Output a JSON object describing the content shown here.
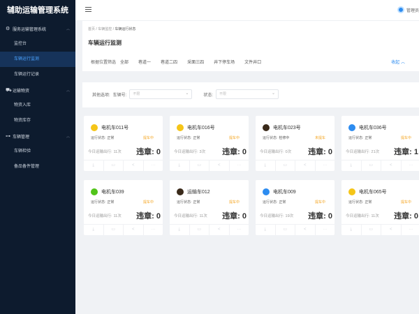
{
  "app_title": "辅助运输管理系统",
  "sidebar": {
    "groups": [
      {
        "label": "服务运输管理系统",
        "icon": "gear-icon"
      },
      {
        "label": "运输物资",
        "icon": "truck-icon"
      },
      {
        "label": "车辆管理",
        "icon": "car-icon"
      }
    ],
    "items": {
      "dashboard": "监控台",
      "monitor": "车辆运行监测",
      "records": "车辆运行记录",
      "material_in": "物资入库",
      "material_stock": "物资库存",
      "inspect": "车辆检验",
      "spare_parts": "备品备件管理"
    }
  },
  "header": {
    "user": "管理员"
  },
  "breadcrumb": [
    "首页",
    "车辆监控",
    "车辆运行状态"
  ],
  "page_title": "车辆运行监测",
  "filters": {
    "location_label": "根据位置筛选",
    "options": [
      "全部",
      "巷道一",
      "巷道二四",
      "采面三四",
      "井下停车场",
      "文件井口"
    ],
    "collapse": "收起",
    "other_label": "其他选项:",
    "vehicle_label": "车辆号:",
    "vehicle_placeholder": "不限",
    "status_label": "状态:",
    "status_placeholder": "不限"
  },
  "labels": {
    "status": "运行状态:",
    "trips": "今日运输出行:",
    "violation_prefix": "违章:"
  },
  "icons": [
    "download-icon",
    "edit-icon",
    "share-icon",
    "more-icon"
  ],
  "cards": [
    {
      "name": "电机车011号",
      "icon_color": "#f5c518",
      "status": "正常",
      "warn": "提车中",
      "trips": "11次",
      "violations": "0"
    },
    {
      "name": "电机车016号",
      "icon_color": "#f5c518",
      "status": "正常",
      "warn": "提车中",
      "trips": "3次",
      "violations": "0"
    },
    {
      "name": "电机车023号",
      "icon_color": "#3a2a1a",
      "status": "检修中",
      "warn": "未提车",
      "trips": "0次",
      "violations": "0"
    },
    {
      "name": "电机车036号",
      "icon_color": "#2d8cf0",
      "status": "正常",
      "warn": "提车中",
      "trips": "21次",
      "violations": "1"
    },
    {
      "name": "电机车039",
      "icon_color": "#52c41a",
      "status": "正常",
      "warn": "提车中",
      "trips": "11次",
      "violations": "0"
    },
    {
      "name": "运输车012",
      "icon_color": "#3a2a1a",
      "status": "正常",
      "warn": "提车中",
      "trips": "11次",
      "violations": "0"
    },
    {
      "name": "电机车009",
      "icon_color": "#2d8cf0",
      "status": "正常",
      "warn": "提车中",
      "trips": "19次",
      "violations": "0"
    },
    {
      "name": "电机车065号",
      "icon_color": "#f5c518",
      "status": "正常",
      "warn": "提车中",
      "trips": "11次",
      "violations": "0"
    }
  ]
}
